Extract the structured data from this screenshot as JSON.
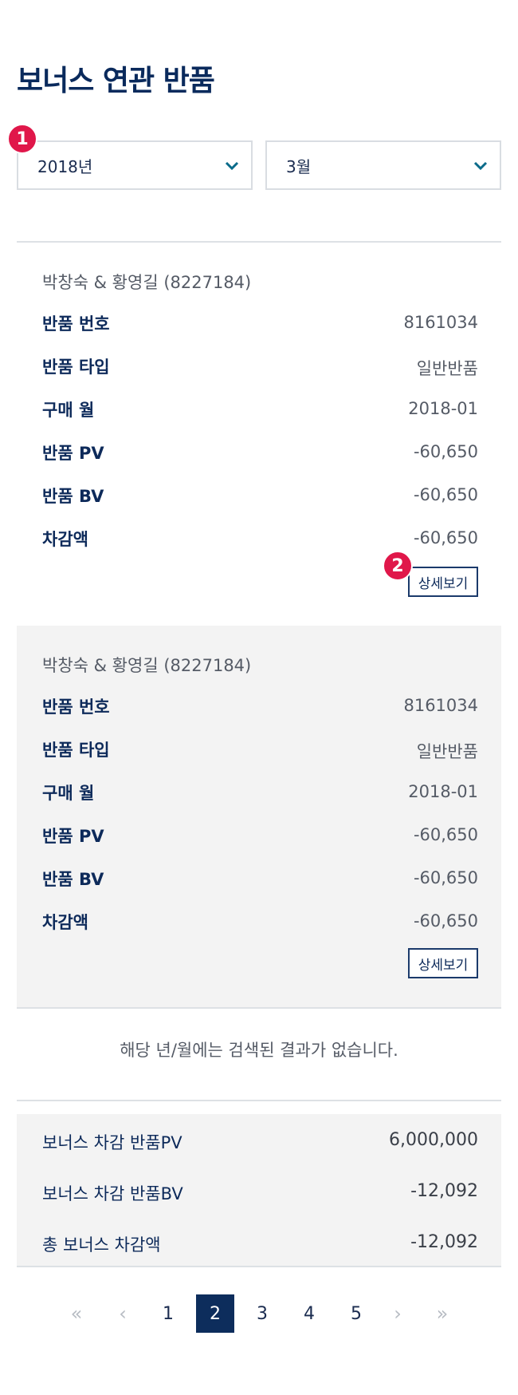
{
  "page": {
    "title": "보너스 연관 반품"
  },
  "filters": {
    "badge": "1",
    "year": {
      "value": "2018년"
    },
    "month": {
      "value": "3월"
    }
  },
  "records": [
    {
      "user": "박창숙 & 황영길 (8227184)",
      "rows": [
        {
          "label": "반품 번호",
          "value": "8161034"
        },
        {
          "label": "반품 타입",
          "value": "일반반품"
        },
        {
          "label": "구매 월",
          "value": "2018-01"
        },
        {
          "label": "반품 PV",
          "value": "-60,650"
        },
        {
          "label": "반품 BV",
          "value": "-60,650"
        },
        {
          "label": "차감액",
          "value": "-60,650"
        }
      ],
      "detail_label": "상세보기",
      "badge": "2"
    },
    {
      "user": "박창숙 & 황영길 (8227184)",
      "rows": [
        {
          "label": "반품 번호",
          "value": "8161034"
        },
        {
          "label": "반품 타입",
          "value": "일반반품"
        },
        {
          "label": "구매 월",
          "value": "2018-01"
        },
        {
          "label": "반품 PV",
          "value": "-60,650"
        },
        {
          "label": "반품 BV",
          "value": "-60,650"
        },
        {
          "label": "차감액",
          "value": "-60,650"
        }
      ],
      "detail_label": "상세보기"
    }
  ],
  "empty_message": "해당 년/월에는 검색된 결과가 없습니다.",
  "summary": [
    {
      "label": "보너스 차감 반품PV",
      "value": "6,000,000"
    },
    {
      "label": "보너스 차감 반품BV",
      "value": "-12,092"
    },
    {
      "label": "총 보너스 차감액",
      "value": "-12,092"
    }
  ],
  "pagination": {
    "first": "«",
    "prev": "‹",
    "pages": [
      "1",
      "2",
      "3",
      "4",
      "5"
    ],
    "current": "2",
    "next": "›",
    "last": "»"
  }
}
